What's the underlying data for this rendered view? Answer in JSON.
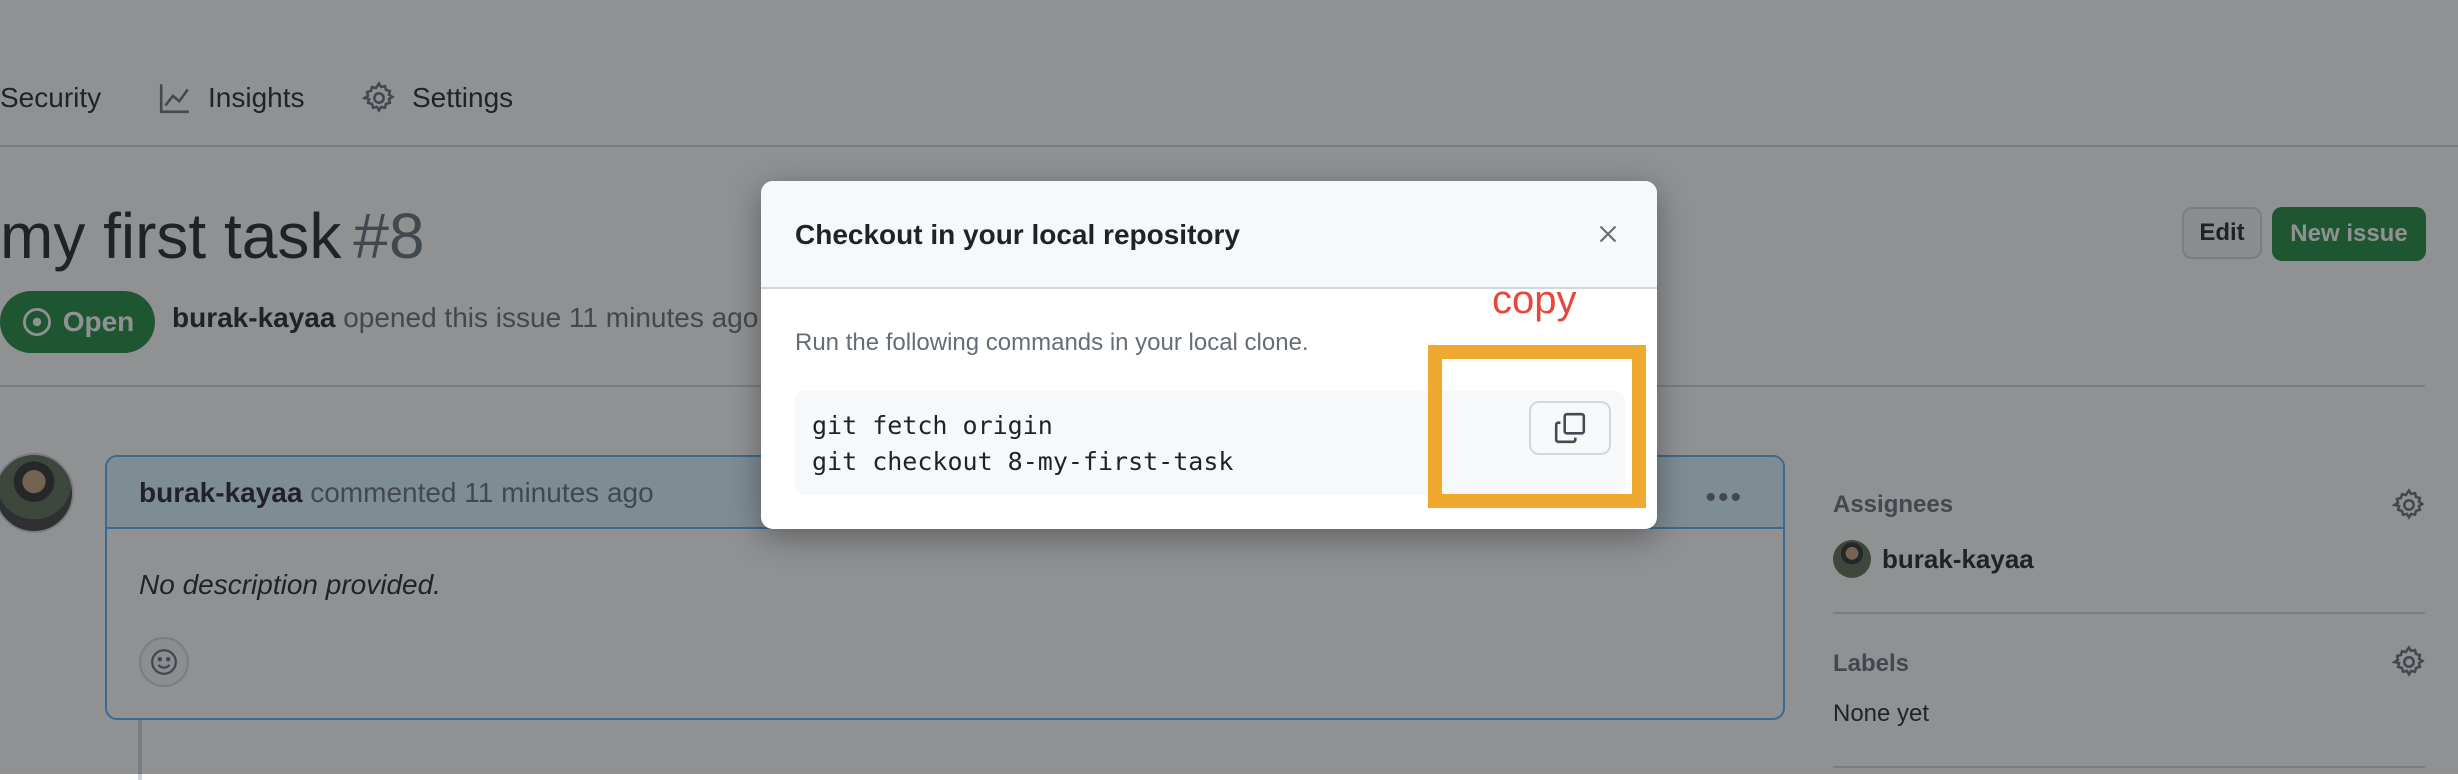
{
  "repo_nav": {
    "items": [
      {
        "label": "Security",
        "icon": "shield-icon"
      },
      {
        "label": "Insights",
        "icon": "graph-icon"
      },
      {
        "label": "Settings",
        "icon": "gear-icon"
      }
    ]
  },
  "issue": {
    "title": "my first task",
    "number": "#8",
    "state": "Open",
    "author": "burak-kayaa",
    "meta_text": " opened this issue 11 minutes ago",
    "edit_label": "Edit",
    "new_issue_label": "New issue"
  },
  "comment": {
    "author": "burak-kayaa",
    "meta_text": " commented 11 minutes ago",
    "body": "No description provided.",
    "menu_glyph": "•••"
  },
  "sidebar": {
    "assignees_heading": "Assignees",
    "assignee": "burak-kayaa",
    "labels_heading": "Labels",
    "labels_value": "None yet"
  },
  "dialog": {
    "title": "Checkout in your local repository",
    "description": "Run the following commands in your local clone.",
    "commands": [
      "git fetch origin",
      "git checkout 8-my-first-task"
    ],
    "close_icon": "x-icon",
    "copy_icon": "copy-icon"
  },
  "annotation": {
    "label": "copy",
    "box_color": "#f0a830",
    "label_color": "#e8483b"
  },
  "colors": {
    "accent_green": "#1f883d",
    "comment_header_bg": "#ddf4ff",
    "comment_border": "#54aeff"
  }
}
